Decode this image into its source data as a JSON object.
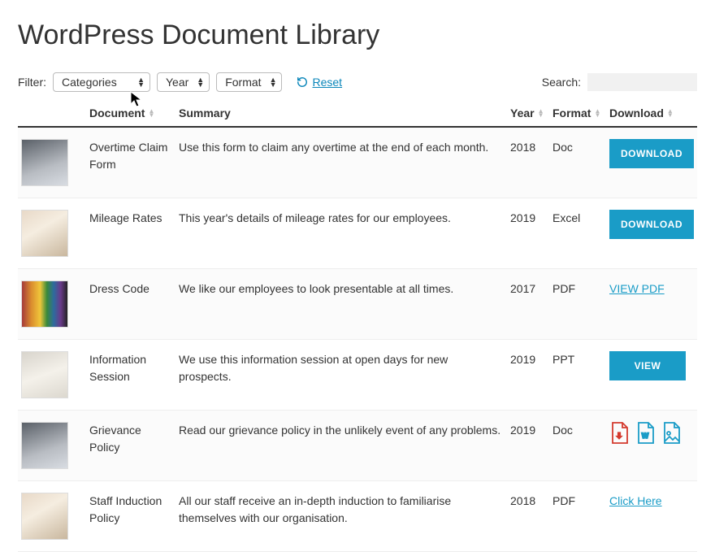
{
  "page_title": "WordPress Document Library",
  "filter_label": "Filter:",
  "filters": {
    "categories_label": "Categories",
    "year_label": "Year",
    "format_label": "Format"
  },
  "reset_label": "Reset",
  "search_label": "Search:",
  "search_value": "",
  "columns": {
    "document": "Document",
    "summary": "Summary",
    "year": "Year",
    "format": "Format",
    "download": "Download"
  },
  "rows": [
    {
      "thumb_style": "kbd",
      "document": "Overtime Claim Form",
      "summary": "Use this form to claim any overtime at the end of each month.",
      "year": "2018",
      "format": "Doc",
      "action_type": "button",
      "action_label": "DOWNLOAD"
    },
    {
      "thumb_style": "hand",
      "document": "Mileage Rates",
      "summary": "This year's details of mileage rates for our employees.",
      "year": "2019",
      "format": "Excel",
      "action_type": "button",
      "action_label": "DOWNLOAD"
    },
    {
      "thumb_style": "pens",
      "document": "Dress Code",
      "summary": "We like our employees to look presentable at all times.",
      "year": "2017",
      "format": "PDF",
      "action_type": "link",
      "action_label": "VIEW PDF"
    },
    {
      "thumb_style": "paper",
      "document": "Information Session",
      "summary": "We use this information session at open days for new prospects.",
      "year": "2019",
      "format": "PPT",
      "action_type": "button",
      "action_label": "VIEW"
    },
    {
      "thumb_style": "kbd",
      "document": "Grievance Policy",
      "summary": "Read our grievance policy in the unlikely event of any problems.",
      "year": "2019",
      "format": "Doc",
      "action_type": "file-icons",
      "action_label": ""
    },
    {
      "thumb_style": "hand",
      "document": "Staff Induction Policy",
      "summary": "All our staff receive an in-depth induction to familiarise themselves with our organisation.",
      "year": "2018",
      "format": "PDF",
      "action_type": "link",
      "action_label": "Click Here"
    }
  ]
}
